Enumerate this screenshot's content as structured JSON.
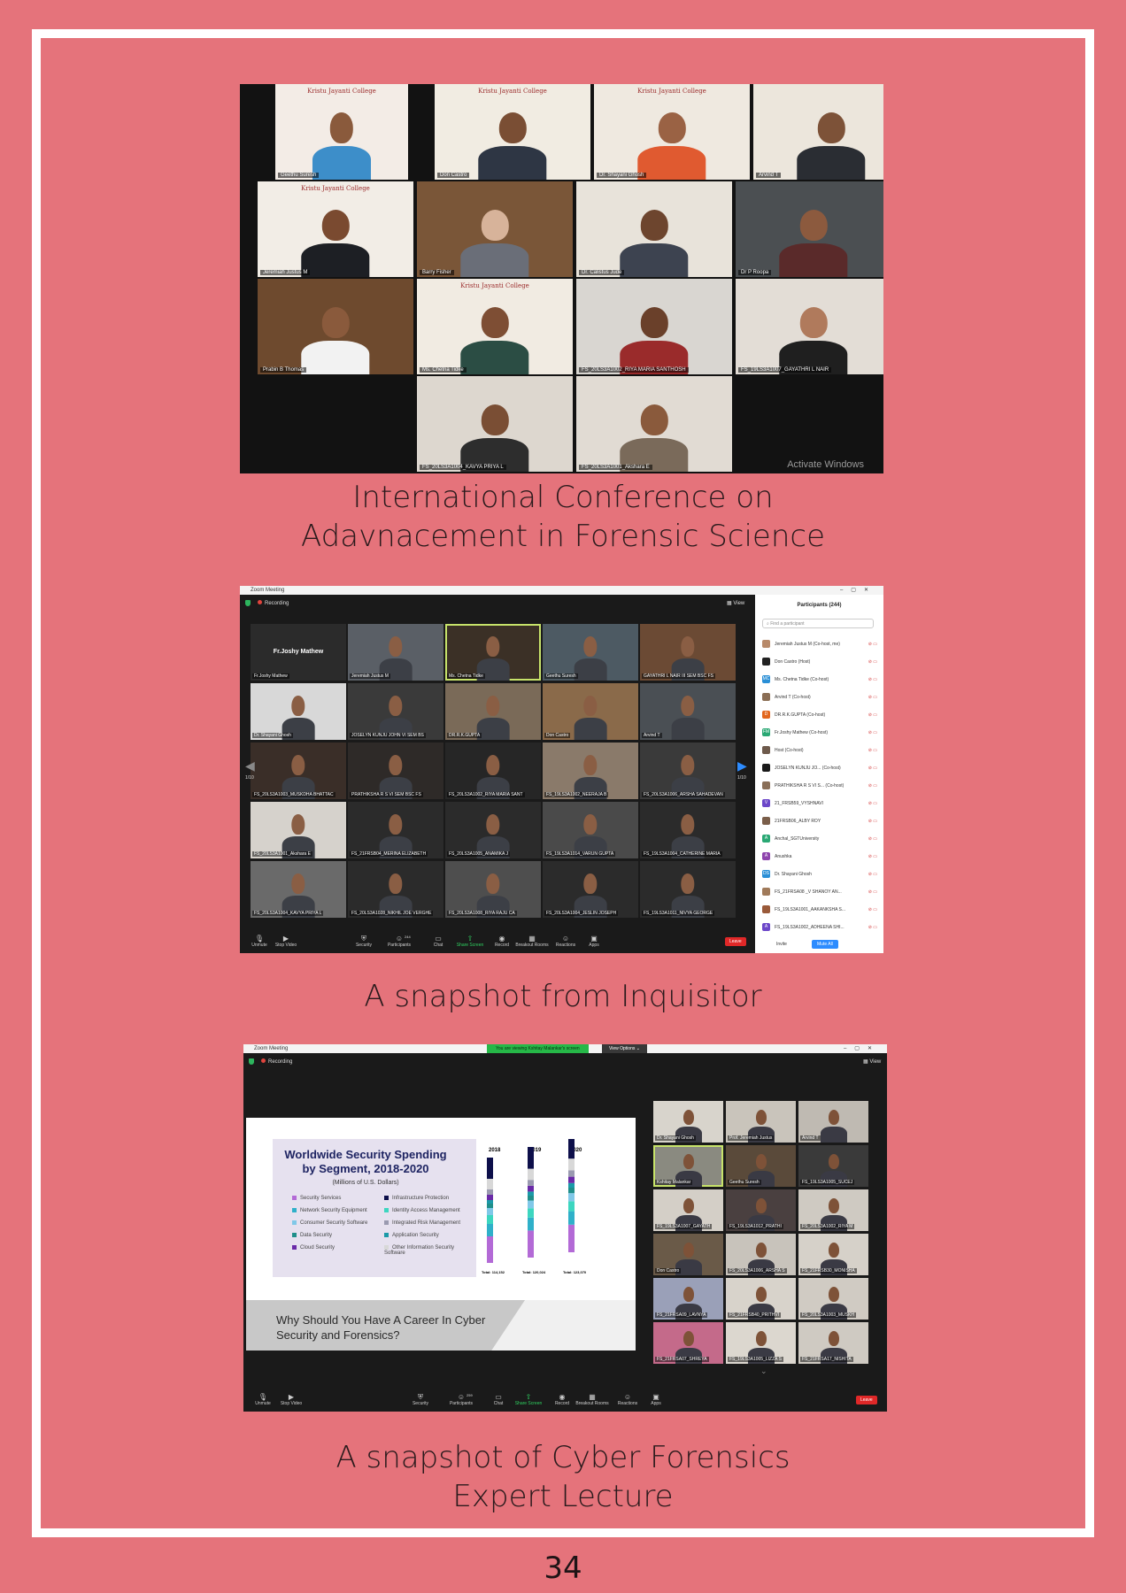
{
  "page_number": "34",
  "captions": {
    "caption1_line1": "International Conference on",
    "caption1_line2": "Adavnacement in Forensic Science",
    "caption2": "A snapshot from Inquisitor",
    "caption3_line1": "A snapshot of Cyber Forensics",
    "caption3_line2": "Expert Lecture"
  },
  "conference": {
    "banner_text": "Kristu Jayanti College",
    "watermark": "Activate Windows",
    "tiles": [
      {
        "name": "Geethu Suresh"
      },
      {
        "name": "Don Castro"
      },
      {
        "name": "Dr. Shayani Ghosh"
      },
      {
        "name": "Arvind T"
      },
      {
        "name": "Jeremiah Justus M"
      },
      {
        "name": "Barry Fisher"
      },
      {
        "name": "Dr. Calistus Jude"
      },
      {
        "name": "Dr P Roopa"
      },
      {
        "name": "Prabin B Thomas"
      },
      {
        "name": "Ms. Chetna Tidke"
      },
      {
        "name": "FS_20LS3A1002_RIYA MARIA SANTHOSH"
      },
      {
        "name": "FS_19LS3A1007_GAYATHRI L NAIR"
      },
      {
        "name": "FS_20LS3A1004_KAVYA PRIYA L"
      },
      {
        "name": "FS_20LS3A1001_Akshara E"
      }
    ]
  },
  "inquisitor": {
    "window_title": "Zoom Meeting",
    "recording": "Recording",
    "view": "View",
    "spotlight_name": "Fr.Joshy Mathew",
    "tiles": [
      "Fr.Joshy Mathew",
      "Jeremiah Justus M",
      "Ms. Chetna Tidke",
      "Geethu Suresh",
      "GAYATHRI L NAIR III SEM BSC FS",
      "Dr. Shayani Ghosh",
      "JOSELYN KUNJU JOHN VI SEM BS",
      "DR.R.K.GUPTA",
      "Don Castro",
      "Arvind T",
      "FS_20LS3A1003_MUSKDHA BHATTAC",
      "PRATHIKSHA R S VI SEM BSC FS",
      "FS_20LS3A1002_RIYA MARIA SANT",
      "FS_19LS3A1002_NEERAJA B",
      "FS_20LS3A1006_ARSHA SAHADEVAN",
      "FS_20LS3A1001_Akshara E",
      "FS_21FRSB04_MERINA ELIZABETH",
      "FS_20LS3A1005_ANAMIKA J",
      "FS_19LS3A1014_VARUN GUPTA",
      "FS_19LS3A1004_CATHERINE MARIA",
      "FS_20LS3A1004_KAVYA PRIYA L",
      "FS_20LS3A1028_NIKHIL JOE VERGHE",
      "FS_20LS3A1008_RIYA RAJU CA",
      "FS_20LS3A1004_JESLIN JOSEPH",
      "FS_19LS3A1011_NIVYA GEORGE"
    ],
    "page_indicator_left": "1/10",
    "page_indicator_right": "1/10",
    "panel_title": "Participants (244)",
    "panel_search": "Find a participant",
    "participants": [
      {
        "name": "Jeremiah Justus M (Co-host, me)",
        "initials": "",
        "color": "#b88a6a"
      },
      {
        "name": "Don Castro (Host)",
        "initials": "",
        "color": "#222222"
      },
      {
        "name": "Ms. Chetna Tidke (Co-host)",
        "initials": "MC",
        "color": "#2a8fd6"
      },
      {
        "name": "Arvind T (Co-host)",
        "initials": "",
        "color": "#8b6e55"
      },
      {
        "name": "DR.R.K.GUPTA (Co-host)",
        "initials": "D",
        "color": "#e2661c"
      },
      {
        "name": "Fr.Joshy Mathew (Co-host)",
        "initials": "FM",
        "color": "#2aa874"
      },
      {
        "name": "Host (Co-host)",
        "initials": "",
        "color": "#6e5a4c"
      },
      {
        "name": "JOSELYN KUNJU JO... (Co-host)",
        "initials": "",
        "color": "#1a1a1a"
      },
      {
        "name": "PRATHIKSHA R S VI S... (Co-host)",
        "initials": "",
        "color": "#8a6f58"
      },
      {
        "name": "21_FRSB59_VYSHNAVI",
        "initials": "V",
        "color": "#6c47c9"
      },
      {
        "name": "21FRSB06_ALBY ROY",
        "initials": "",
        "color": "#7a5e4a"
      },
      {
        "name": "Anchal_SGTUniversity",
        "initials": "A",
        "color": "#2aa874"
      },
      {
        "name": "Anushka",
        "initials": "A",
        "color": "#8e44ad"
      },
      {
        "name": "Dr. Shayani Ghosh",
        "initials": "DS",
        "color": "#2a8fd6"
      },
      {
        "name": "FS_21FRSA08 _V SHANOY AN...",
        "initials": "",
        "color": "#a07a5a"
      },
      {
        "name": "FS_19LS3A1001_AAKANKSHA S...",
        "initials": "",
        "color": "#9a5a3a"
      },
      {
        "name": "FS_19LS3A1002_ADHEENA SHI...",
        "initials": "A",
        "color": "#6c47c9"
      }
    ],
    "panel_invite": "Invite",
    "panel_mute_all": "Mute All",
    "toolbar": [
      {
        "label": "Unmute",
        "icon": "mic-icon"
      },
      {
        "label": "Stop Video",
        "icon": "video-icon"
      },
      {
        "label": "Security",
        "icon": "shield-icon"
      },
      {
        "label": "Participants",
        "icon": "people-icon",
        "count": "244"
      },
      {
        "label": "Chat",
        "icon": "chat-icon"
      },
      {
        "label": "Share Screen",
        "icon": "share-icon"
      },
      {
        "label": "Record",
        "icon": "record-icon"
      },
      {
        "label": "Breakout Rooms",
        "icon": "grid-icon"
      },
      {
        "label": "Reactions",
        "icon": "smile-icon"
      },
      {
        "label": "Apps",
        "icon": "apps-icon"
      }
    ],
    "leave": "Leave"
  },
  "cyber": {
    "window_title": "Zoom Meeting",
    "viewing_banner": "You are viewing Kshitay Malankar's screen",
    "view_options": "View Options",
    "recording": "Recording",
    "view": "View",
    "slide": {
      "title_line1": "Worldwide Security Spending",
      "title_line2": "by Segment, 2018-2020",
      "subtitle": "(Millions of U.S. Dollars)",
      "legend": [
        {
          "label": "Security Services",
          "color": "#b36ad6"
        },
        {
          "label": "Infrastructure Protection",
          "color": "#0d0f4a"
        },
        {
          "label": "Network Security Equipment",
          "color": "#2fb0c9"
        },
        {
          "label": "Identity Access Management",
          "color": "#3dd6c0"
        },
        {
          "label": "Consumer Security Software",
          "color": "#80c8e8"
        },
        {
          "label": "Integrated Risk Management",
          "color": "#9a9ab0"
        },
        {
          "label": "Data Security",
          "color": "#1f8f8a"
        },
        {
          "label": "Application Security",
          "color": "#1b9aa8"
        },
        {
          "label": "Cloud Security",
          "color": "#6a2aa8"
        },
        {
          "label": "Other Information Security Software",
          "color": "#d8d8d8"
        }
      ],
      "years": [
        "2018",
        "2019",
        "2020"
      ],
      "totals": [
        "Total: 114,152",
        "Total: 120,024",
        "Total: 123,070"
      ],
      "banner": "Why Should You Have A Career In Cyber Security and Forensics?"
    },
    "tiles": [
      "Dr. Shayani Ghosh",
      "Prof. Jeremiah Justus",
      "Arvind T",
      "Kshitay Malankar",
      "Geethu Suresh",
      "FS_19LS3A1005_SUCEJ",
      "FS_19LS3A1007_GAYATH",
      "FS_19LS3A1012_PRATHI",
      "FS_20LS3A1002_RIYA M",
      "Don Castro",
      "FS_20LS3A1006_ARSHA S",
      "FS_21FRSB30_MONISHA",
      "FS_21FRSA09_LAVNYA",
      "FS_21FRSB40_PRITHVI",
      "FS_20LS3A1003_MUSKH",
      "FS_21FRSA07_SHREYA",
      "FS_19LS3A1005_LIZZA S",
      "FS_21FRSA17_NISHITA"
    ],
    "toolbar": [
      {
        "label": "Unmute",
        "icon": "mic-icon"
      },
      {
        "label": "Stop Video",
        "icon": "video-icon"
      },
      {
        "label": "Security",
        "icon": "shield-icon"
      },
      {
        "label": "Participants",
        "icon": "people-icon",
        "count": "259"
      },
      {
        "label": "Chat",
        "icon": "chat-icon"
      },
      {
        "label": "Share Screen",
        "icon": "share-icon"
      },
      {
        "label": "Record",
        "icon": "record-icon"
      },
      {
        "label": "Breakout Rooms",
        "icon": "grid-icon"
      },
      {
        "label": "Reactions",
        "icon": "smile-icon"
      },
      {
        "label": "Apps",
        "icon": "apps-icon"
      }
    ],
    "leave": "Leave"
  }
}
